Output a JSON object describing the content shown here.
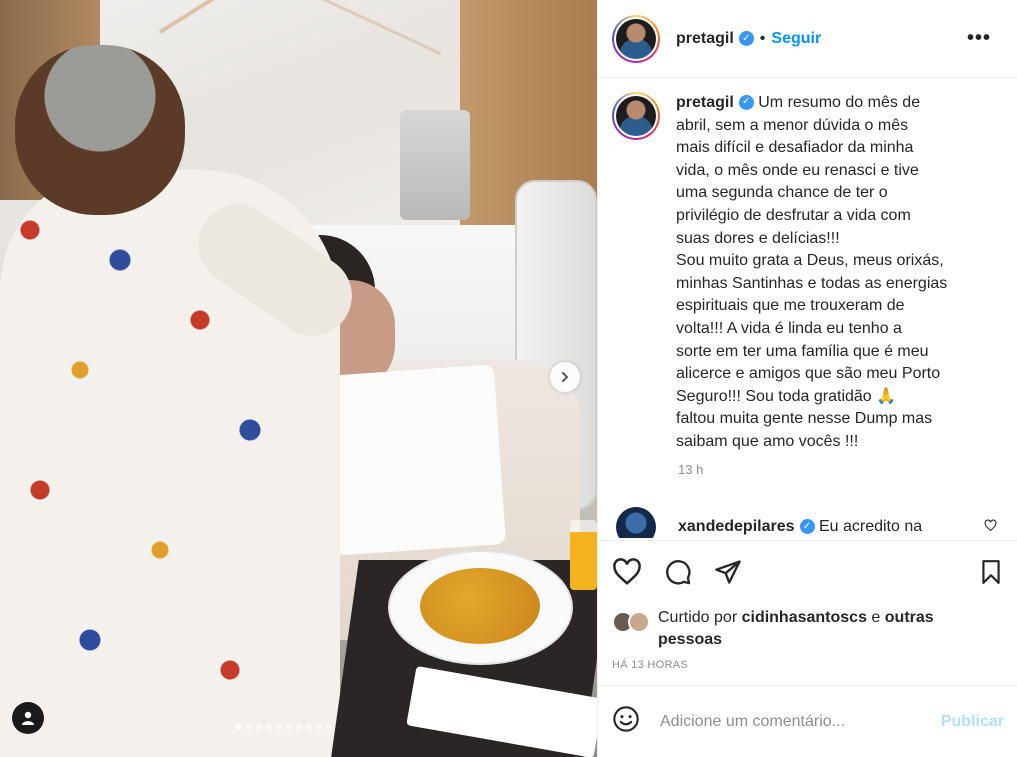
{
  "post": {
    "account": "pretagil",
    "follow_label": "Seguir",
    "more_label": "•••",
    "separator": "•",
    "caption_user": "pretagil",
    "caption_lines": [
      "Um resumo do mês de",
      "abril, sem a menor dúvida o mês",
      "mais difícil e desafiador da minha",
      "vida, o mês onde eu renasci e tive",
      "uma segunda chance de ter o",
      "privilégio de desfrutar a vida com",
      "suas dores e delícias!!!",
      "Sou muito grata a Deus, meus orixás,",
      "minhas Santinhas e todas as energias",
      "espirituais que me trouxeram de",
      "volta!!! A vida é linda eu tenho a",
      "sorte em ter uma família que é meu",
      "alicerce e amigos que são meu Porto",
      "Seguro!!! Sou toda gratidão 🙏",
      "faltou muita gente nesse Dump mas",
      "saibam que amo vocês !!!"
    ],
    "caption_time": "13 h",
    "comment": {
      "user": "xandedepilares",
      "text": "Eu acredito na"
    },
    "likes": {
      "prefix": "Curtido por ",
      "user": "cidinhasantoscs",
      "middle": " e ",
      "others": "outras pessoas"
    },
    "timestamp": "HÁ 13 HORAS",
    "comment_placeholder": "Adicione um comentário...",
    "publish_label": "Publicar",
    "carousel": {
      "total": 10,
      "active": 0
    },
    "colors": {
      "accent": "#0095f6",
      "verified": "#3897f0",
      "publish_disabled": "#b2dffc"
    },
    "icons": [
      "heart-icon",
      "comment-icon",
      "share-icon",
      "bookmark-icon",
      "emoji-icon",
      "next-arrow-icon",
      "user-tag-icon",
      "verified-icon"
    ]
  }
}
